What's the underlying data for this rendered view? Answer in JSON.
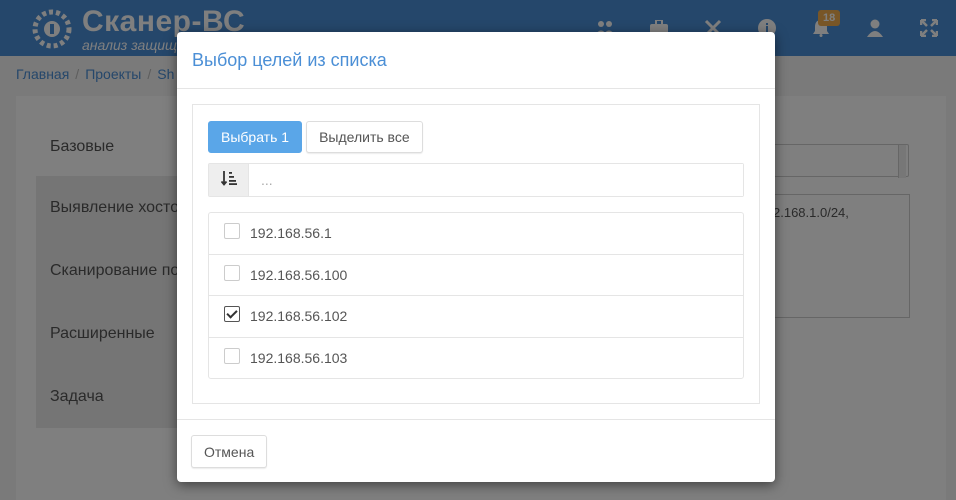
{
  "app": {
    "title": "Сканер-ВС",
    "subtitle": "анализ защищ",
    "notification_count": "18"
  },
  "nav_icons": [
    "users-icon",
    "briefcase-icon",
    "tools-icon",
    "info-icon",
    "bell-icon",
    "user-icon",
    "fullscreen-icon"
  ],
  "breadcrumb": {
    "items": [
      "Главная",
      "Проекты",
      "Sh"
    ]
  },
  "side_menu": {
    "items": [
      "Базовые",
      "Выявление хосто",
      "Сканирование по",
      "Расширенные",
      "Задача"
    ]
  },
  "background_form": {
    "textarea_value": "2.168.1.0/24,"
  },
  "modal": {
    "title": "Выбор целей из списка",
    "select_button": "Выбрать 1",
    "select_all_button": "Выделить все",
    "filter_placeholder": "...",
    "items": [
      {
        "label": "192.168.56.1",
        "checked": false
      },
      {
        "label": "192.168.56.100",
        "checked": false
      },
      {
        "label": "192.168.56.102",
        "checked": true
      },
      {
        "label": "192.168.56.103",
        "checked": false
      }
    ],
    "cancel_button": "Отмена"
  },
  "colors": {
    "navbar": "#4b8fd6",
    "accent": "#5aa6e8",
    "badge": "#f0ad4e"
  }
}
